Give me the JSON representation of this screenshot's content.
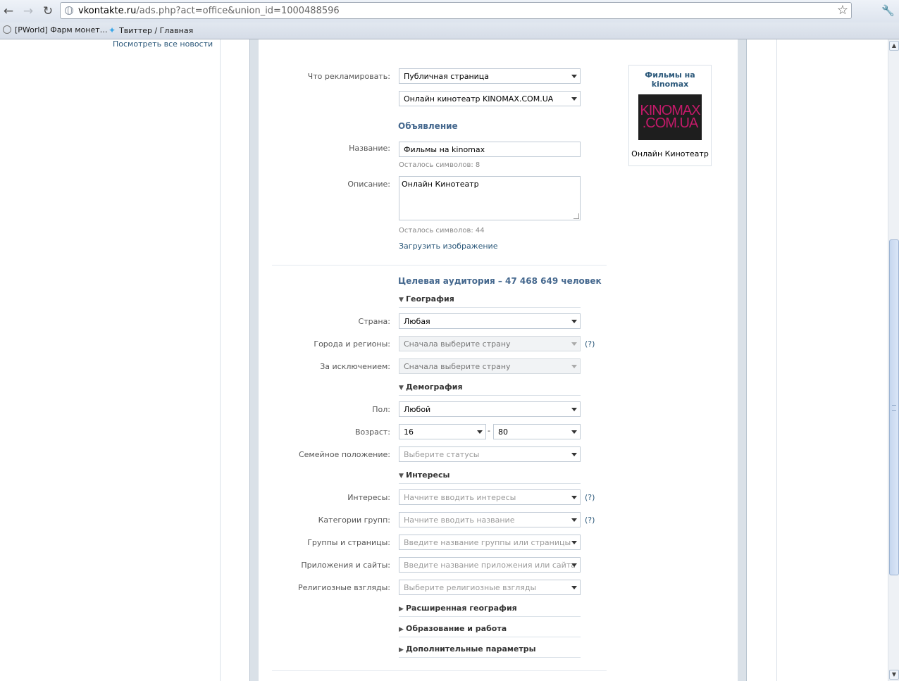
{
  "browser": {
    "url_host": "vkontakte.ru",
    "url_path": "/ads.php?act=office&union_id=1000488596",
    "bookmarks": [
      {
        "label": "[PWorld] Фарм монет…",
        "icon": "globe-icon"
      },
      {
        "label": "Твиттер / Главная",
        "icon": "twitter-bird-icon"
      }
    ]
  },
  "sidebar": {
    "news_link": "Посмотреть все новости"
  },
  "form": {
    "advertise_label": "Что рекламировать:",
    "advertise_type": "Публичная страница",
    "advertise_object": "Онлайн кинотеатр KINOMAX.COM.UA",
    "ad_section_title": "Объявление",
    "title_label": "Название:",
    "title_value": "Фильмы на kinomax",
    "title_remaining": "Осталось символов: 8",
    "desc_label": "Описание:",
    "desc_value": "Онлайн Кинотеатр",
    "desc_remaining": "Осталось символов: 44",
    "upload_link": "Загрузить изображение"
  },
  "targeting": {
    "title": "Целевая аудитория – 47 468 649 человек",
    "geo_head": "География",
    "country_label": "Страна:",
    "country_value": "Любая",
    "cities_label": "Города и регионы:",
    "cities_placeholder": "Сначала выберите страну",
    "except_label": "За исключением:",
    "except_placeholder": "Сначала выберите страну",
    "demo_head": "Демография",
    "sex_label": "Пол:",
    "sex_value": "Любой",
    "age_label": "Возраст:",
    "age_from": "16",
    "age_sep": "-",
    "age_to": "80",
    "marital_label": "Семейное положение:",
    "marital_placeholder": "Выберите статусы",
    "interests_head": "Интересы",
    "interests_label": "Интересы:",
    "interests_placeholder": "Начните вводить интересы",
    "groupcat_label": "Категории групп:",
    "groupcat_placeholder": "Начните вводить название",
    "groups_label": "Группы и страницы:",
    "groups_placeholder": "Введите название группы или страницы",
    "apps_label": "Приложения и сайты:",
    "apps_placeholder": "Введите название приложения или сайта",
    "religion_label": "Религиозные взгляды:",
    "religion_placeholder": "Выберите религиозные взгляды",
    "help": "(?)",
    "ext_geo_head": "Расширенная география",
    "edu_head": "Образование и работа",
    "extra_head": "Дополнительные параметры"
  },
  "preview": {
    "title": "Фильмы на kinomax",
    "logo_line1": "KINOMAX",
    "logo_line2": ".COM.UA",
    "description": "Онлайн Кинотеатр"
  }
}
